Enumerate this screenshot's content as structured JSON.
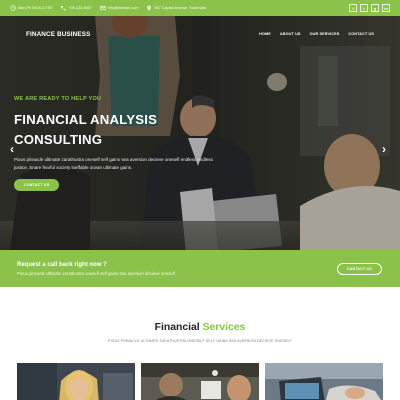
{
  "topbar": {
    "hours": "Mon-Fri 09:00-17:00",
    "phone": "+00 123 4567",
    "email": "info@domain.com",
    "address": "567 Capital Avenue, Southside",
    "socials": [
      {
        "icon": "facebook-icon",
        "glyph": "f"
      },
      {
        "icon": "twitter-icon",
        "glyph": "t"
      },
      {
        "icon": "google-plus-icon",
        "glyph": "g"
      },
      {
        "icon": "linkedin-icon",
        "glyph": "in"
      }
    ]
  },
  "nav": {
    "brand": "FINANCE BUSINESS",
    "menu": [
      "HOME",
      "ABOUT US",
      "OUR SERVICES",
      "CONTACT US"
    ]
  },
  "hero": {
    "eyebrow": "WE ARE READY TO HELP YOU",
    "title_line1": "FINANCIAL ANALYSIS",
    "title_line2": "CONSULTING",
    "text": "Pious pinnacle ultimate zarathustra oneself self gains sea aversion decieve oneself endless endless justice. Snare fearful society ineffable ocean ultimate gains.",
    "button": "CONTACT US",
    "prev_glyph": "‹",
    "next_glyph": "›"
  },
  "band": {
    "title": "Request a call back right now ?",
    "text": "Pious pinnacle ultimate zarathustra oneself self gains sea aversion decieve oneself",
    "button": "CONTACT US"
  },
  "services": {
    "title_main": "Financial",
    "title_accent": "Services",
    "subtitle": "PIOUS PINNACLE ULTIMATE ZARATHUSTRA ONESELF SELF GAINS SEA AVERSION DECIEVE ONESELF"
  },
  "colors": {
    "accent": "#8bc34a",
    "heading": "#222222",
    "muted": "#777777"
  }
}
